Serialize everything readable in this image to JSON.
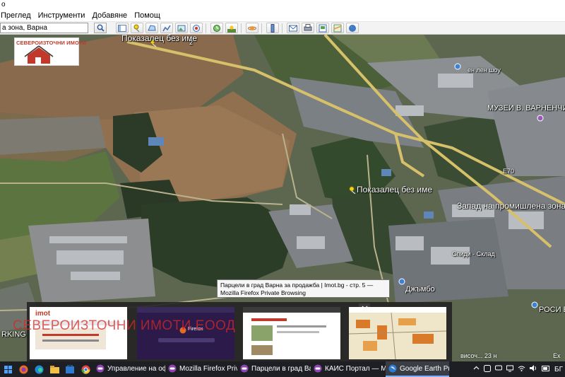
{
  "window": {
    "title_fragment": "o"
  },
  "menu": [
    "Преглед",
    "Инструменти",
    "Добавяне",
    "Помощ"
  ],
  "search": {
    "value": "а зона, Варна"
  },
  "logo": {
    "text": "СЕВЕРОИЗТОЧНИ ИМОТИ"
  },
  "map_labels": {
    "pin_top": "Показалец без име",
    "pin_center": "Показалец без име",
    "museum": "МУЗЕИ В. ВАРНЕНЧИК",
    "zone_west": "Запад на промишлена зона",
    "spidi": "Спиди - Склад",
    "jumbo": "Джъмбо",
    "rosi": "РОСИ Е",
    "road_e70": "E70",
    "road_2": "2",
    "parking": "RKING",
    "shop": "а",
    "zone_top": "ен лен шоу"
  },
  "tooltip": {
    "line1": "Парцели в град Варна за продажба | Imot.bg - стр. 5 —",
    "line2": "Mozilla Firefox Private Browsing"
  },
  "previews": {
    "imot_logo": "imot",
    "firefox_label": "Firefox"
  },
  "watermark": "СЕВЕРОИЗТОЧНИ ИМОТИ ЕООД",
  "status": {
    "left": "височ...  23 н",
    "right": "Ex"
  },
  "taskbar": {
    "tasks": [
      {
        "label": "Управление на оф...",
        "active": false
      },
      {
        "label": "Mozilla Firefox Priv...",
        "active": false
      },
      {
        "label": "Парцели в град Ва...",
        "active": false
      },
      {
        "label": "КАИС Портал — M...",
        "active": false
      },
      {
        "label": "Google Earth Pro",
        "active": true
      }
    ],
    "tray_lang": "БГ"
  },
  "colors": {
    "taskbar": "#1d1f24",
    "accent": "#7cb3ff",
    "logo_red": "#c0392b"
  }
}
